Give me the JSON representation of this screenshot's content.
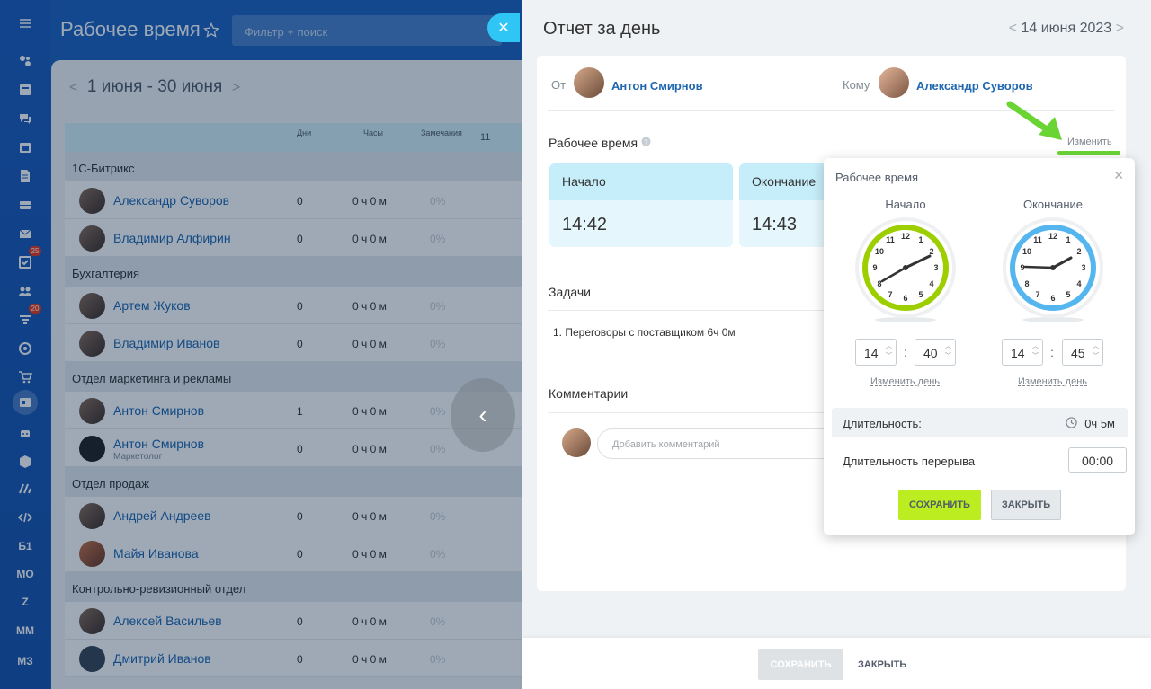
{
  "sidebar": {
    "badges": {
      "tasks": "25",
      "feed": "20"
    },
    "text_items": [
      "Б1",
      "МО",
      "Z",
      "ММ",
      "МЗ"
    ]
  },
  "app": {
    "title": "Рабочее время",
    "search_placeholder": "Фильтр + поиск"
  },
  "report": {
    "period": "1 июня - 30 июня",
    "columns": {
      "days": "Дни",
      "hours": "Часы",
      "remarks": "Замечания",
      "day11": "11"
    },
    "groups": [
      {
        "name": "1С-Битрикс",
        "rows": [
          {
            "name": "Александр Суворов",
            "days": "0",
            "hours": "0 ч 0 м",
            "remarks": "0%"
          },
          {
            "name": "Владимир Алфирин",
            "days": "0",
            "hours": "0 ч 0 м",
            "remarks": "0%"
          }
        ]
      },
      {
        "name": "Бухгалтерия",
        "rows": [
          {
            "name": "Артем Жуков",
            "days": "0",
            "hours": "0 ч 0 м",
            "remarks": "0%"
          },
          {
            "name": "Владимир Иванов",
            "days": "0",
            "hours": "0 ч 0 м",
            "remarks": "0%"
          }
        ]
      },
      {
        "name": "Отдел маркетинга и рекламы",
        "rows": [
          {
            "name": "Антон Смирнов",
            "days": "1",
            "hours": "0 ч 0 м",
            "remarks": "0%"
          },
          {
            "name": "Антон Смирнов",
            "subtitle": "Маркетолог",
            "days": "0",
            "hours": "0 ч 0 м",
            "remarks": "0%"
          }
        ]
      },
      {
        "name": "Отдел продаж",
        "rows": [
          {
            "name": "Андрей Андреев",
            "days": "0",
            "hours": "0 ч 0 м",
            "remarks": "0%"
          },
          {
            "name": "Майя Иванова",
            "days": "0",
            "hours": "0 ч 0 м",
            "remarks": "0%"
          }
        ]
      },
      {
        "name": "Контрольно-ревизионный отдел",
        "rows": [
          {
            "name": "Алексей Васильев",
            "days": "0",
            "hours": "0 ч 0 м",
            "remarks": "0%"
          },
          {
            "name": "Дмитрий Иванов",
            "days": "0",
            "hours": "0 ч 0 м",
            "remarks": "0%"
          }
        ]
      }
    ]
  },
  "slider": {
    "title": "Отчет за день",
    "date": "14 июня 2023",
    "from_label": "От",
    "from_name": "Антон Смирнов",
    "to_label": "Кому",
    "to_name": "Александр Суворов",
    "work_time_label": "Рабочее время",
    "change_link": "Изменить",
    "start_label": "Начало",
    "start_value": "14:42",
    "end_label": "Окончание",
    "end_value": "14:43",
    "tasks_label": "Задачи",
    "task_1": "1. Переговоры с поставщиком 6ч 0м",
    "comments_label": "Комментарии",
    "comment_placeholder": "Добавить комментарий",
    "footer_save": "СОХРАНИТЬ",
    "footer_close": "ЗАКРЫТЬ"
  },
  "popup": {
    "title": "Рабочее время",
    "start_label": "Начало",
    "end_label": "Окончание",
    "start_hour": "14",
    "start_min": "40",
    "end_hour": "14",
    "end_min": "45",
    "change_day": "Изменить день",
    "duration_label": "Длительность:",
    "duration_value": "0ч 5м",
    "break_label": "Длительность перерыва",
    "break_value": "00:00",
    "save": "СОХРАНИТЬ",
    "close": "ЗАКРЫТЬ",
    "start_clock_color": "#9dcf00",
    "end_clock_color": "#55b6ef"
  }
}
